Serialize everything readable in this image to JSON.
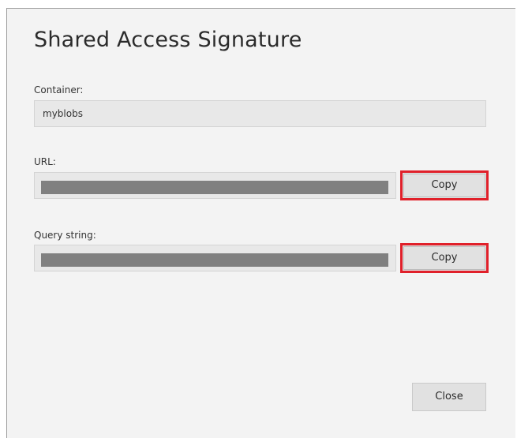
{
  "dialog": {
    "title": "Shared Access Signature",
    "container": {
      "label": "Container:",
      "value": "myblobs"
    },
    "url": {
      "label": "URL:",
      "copy_label": "Copy"
    },
    "query": {
      "label": "Query string:",
      "copy_label": "Copy"
    },
    "close_label": "Close"
  },
  "colors": {
    "highlight": "#e0202a",
    "masked": "#808080",
    "dialog_bg": "#f3f3f3"
  }
}
